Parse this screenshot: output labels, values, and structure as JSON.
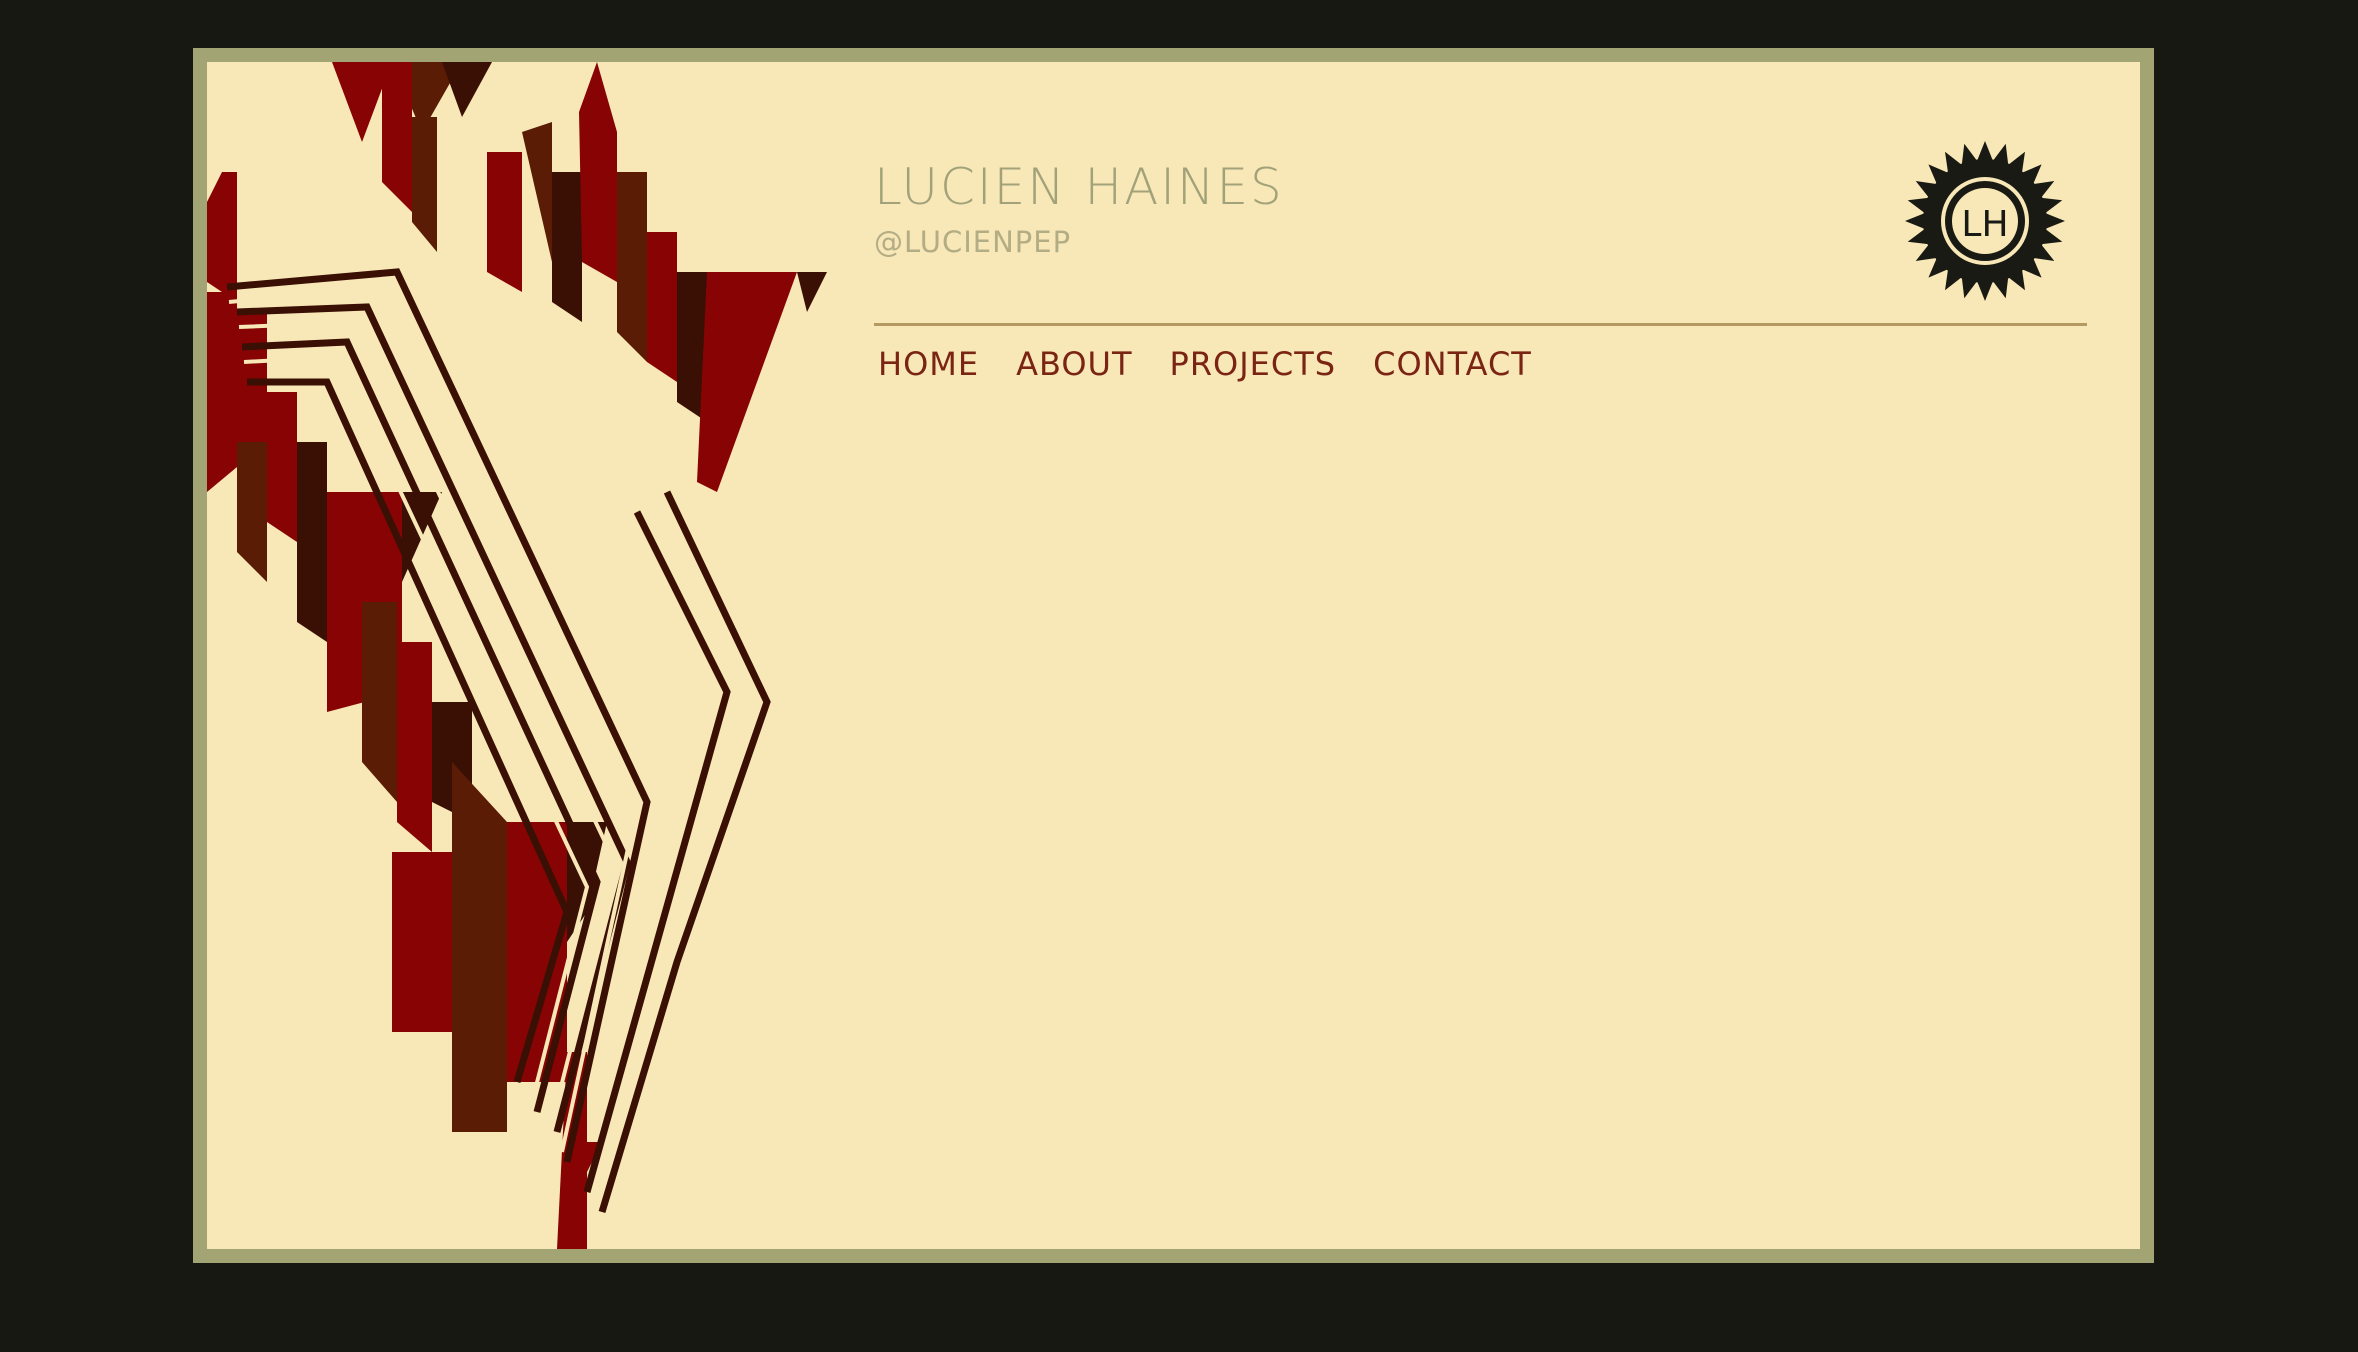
{
  "site": {
    "title": "LUCIEN HAINES",
    "handle": "@LUCIENPEP",
    "logo_monogram": "LH"
  },
  "nav": {
    "items": [
      {
        "label": "HOME"
      },
      {
        "label": "ABOUT"
      },
      {
        "label": "PROJECTS"
      },
      {
        "label": "CONTACT"
      }
    ]
  },
  "colors": {
    "page_background": "#161811",
    "frame": "#a2a474",
    "panel": "#f8e7b7",
    "accent_red": "#880404",
    "accent_brown": "#5a1c04",
    "accent_dark": "#3a0f04",
    "nav_text": "#7a2414",
    "title_text": "#a2a27a",
    "rule": "#b49a62"
  },
  "icons": {
    "logo": "lh-monogram-rosette-icon"
  }
}
